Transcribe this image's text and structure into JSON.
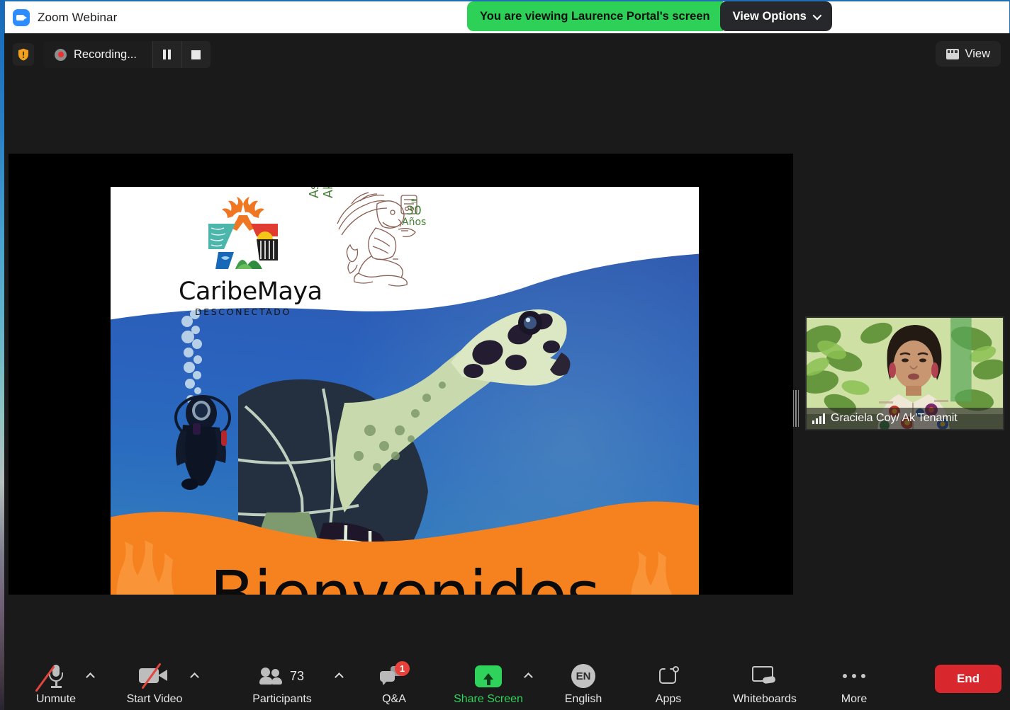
{
  "window": {
    "app_title": "Zoom Webinar",
    "logo_icon": "zoom-video-logo-icon"
  },
  "share_banner": {
    "viewing_text": "You are viewing Laurence Portal's screen",
    "view_options_label": "View Options",
    "view_options_icon": "chevron-down-icon",
    "banner_color": "#2ed157"
  },
  "recording_bar": {
    "shield_icon": "security-shield-icon",
    "record_icon": "record-dot-icon",
    "status_label": "Recording...",
    "pause_icon": "pause-icon",
    "stop_icon": "stop-icon"
  },
  "view_control": {
    "label": "View",
    "icon": "layout-grid-icon"
  },
  "shared_slide": {
    "caribemaya": {
      "name": "CaribeMaya",
      "subtitle": "DESCONECTADO",
      "mark_icon": "caribemaya-star-coral-logo-icon"
    },
    "aktenamit": {
      "line1": "Asociación",
      "line2": "Ak’Tenamit",
      "anniversary_number": "30",
      "anniversary_unit": "Años",
      "figure_icon": "mayan-figure-icon"
    },
    "headline": "Bienvenidos",
    "cursor_icon": "ring-cursor-icon",
    "colors": {
      "ocean_blue": "#2a62bd",
      "band_orange": "#f5821f",
      "accent_green": "#3f7d32"
    }
  },
  "participant_thumbnail": {
    "name": "Graciela Coy/  Ak’Tenamit",
    "signal_icon": "signal-bars-icon"
  },
  "toolbar": {
    "items": [
      {
        "label": "Unmute",
        "icon": "microphone-muted-icon",
        "caret": true,
        "badge": null,
        "accent": false
      },
      {
        "label": "Start Video",
        "icon": "camera-off-icon",
        "caret": true,
        "badge": null,
        "accent": false
      },
      {
        "label": "Participants",
        "icon": "participants-icon",
        "caret": true,
        "badge": null,
        "accent": false,
        "count": "73"
      },
      {
        "label": "Q&A",
        "icon": "question-answer-icon",
        "caret": false,
        "badge": "1",
        "accent": false
      },
      {
        "label": "Share Screen",
        "icon": "share-screen-icon",
        "caret": true,
        "badge": null,
        "accent": true
      },
      {
        "label": "English",
        "icon": "language-en-icon",
        "caret": false,
        "badge": null,
        "accent": false,
        "code": "EN"
      },
      {
        "label": "Apps",
        "icon": "apps-icon",
        "caret": false,
        "badge": null,
        "accent": false
      },
      {
        "label": "Whiteboards",
        "icon": "whiteboard-icon",
        "caret": false,
        "badge": null,
        "accent": false
      },
      {
        "label": "More",
        "icon": "more-ellipsis-icon",
        "caret": false,
        "badge": null,
        "accent": false
      }
    ],
    "end_label": "End",
    "end_color": "#d8282d"
  }
}
